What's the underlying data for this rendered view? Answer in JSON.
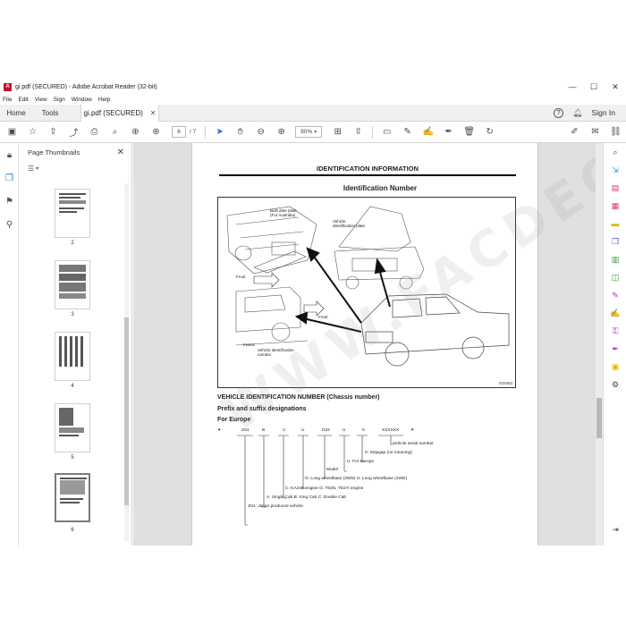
{
  "window": {
    "title": "gi.pdf (SECURED) - Adobe Acrobat Reader (32-bit)",
    "app_icon": "A"
  },
  "menu": [
    "File",
    "Edit",
    "View",
    "Sign",
    "Window",
    "Help"
  ],
  "tabs": {
    "home": "Home",
    "tools": "Tools",
    "doc": "gi.pdf (SECURED)"
  },
  "header": {
    "sign_in": "Sign In"
  },
  "toolbar": {
    "page_current": "6",
    "page_total": "/  7",
    "zoom": "80%"
  },
  "thumbnails": {
    "title": "Page Thumbnails",
    "pages": [
      "2",
      "3",
      "4",
      "5",
      "6"
    ],
    "selected": "6"
  },
  "document": {
    "title": "IDENTIFICATION INFORMATION",
    "subtitle": "Identification Number",
    "figure": {
      "built_plate": "Built date plate\n(For Australia)",
      "vehicle_plate": "Vehicle\nidentification plate",
      "front_1": "Front",
      "front_2": "Front",
      "frame": "Frame",
      "vin_label": "Vehicle identification\nnumber",
      "code": "SGI663"
    },
    "heading1": "VEHICLE IDENTIFICATION NUMBER (Chassis number)",
    "heading2": "Prefix and suffix designations",
    "heading3": "For Europe",
    "code_fields": [
      "JN1",
      "B",
      "C",
      "U",
      "D22",
      "U",
      "0",
      "XXXXXX"
    ],
    "legend": {
      "serial": "Vehicle serial number",
      "stopgap": "0: Stopgap (no meaning)",
      "for_europe": "U: For Europe",
      "model": "Model",
      "wheelbase": "G: Long wheelbase (2WD)   U: Long wheelbase (4WD)",
      "engine": "C: KA24E engine   G: TD25, TD27i engine",
      "cab": "A: Single Cab   B: King Cab   C: Double Cab",
      "maker": "JN1: Japan produced vehicle"
    },
    "watermark": "WWW.FACDECO.COM"
  },
  "colors": {
    "accent": "#1473e6",
    "doc_bg": "#e0e0e0",
    "brand_red": "#c8102e"
  }
}
